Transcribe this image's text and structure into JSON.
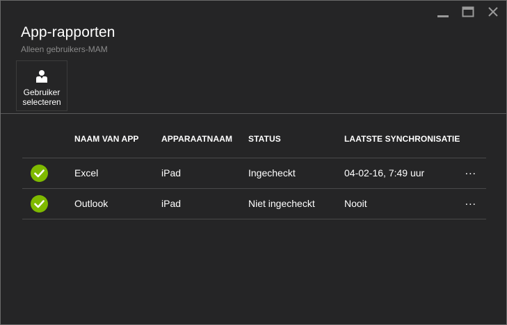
{
  "blade": {
    "title": "App-rapporten",
    "subtitle": "Alleen gebruikers-MAM"
  },
  "window_controls": {
    "minimize_icon": "minimize-icon",
    "maximize_icon": "maximize-icon",
    "close_icon": "close-icon"
  },
  "command_bar": {
    "select_user": {
      "icon": "user-icon",
      "label_line1": "Gebruiker",
      "label_line2": "selecteren"
    }
  },
  "grid": {
    "columns": {
      "app_name": "NAAM VAN APP",
      "device_name": "APPARAATNAAM",
      "status": "STATUS",
      "last_sync": "LAATSTE SYNCHRONISATIE"
    },
    "rows": [
      {
        "status_icon": "check-circle-icon",
        "app_name": "Excel",
        "device_name": "iPad",
        "status": "Ingecheckt",
        "last_sync": "04-02-16, 7:49 uur",
        "more": "..."
      },
      {
        "status_icon": "check-circle-icon",
        "app_name": "Outlook",
        "device_name": "iPad",
        "status": "Niet ingecheckt",
        "last_sync": "Nooit",
        "more": "..."
      }
    ]
  },
  "colors": {
    "background": "#252526",
    "success_green": "#7fba00",
    "subtitle_gray": "#8a8a8a",
    "divider": "#4a4a4a"
  }
}
